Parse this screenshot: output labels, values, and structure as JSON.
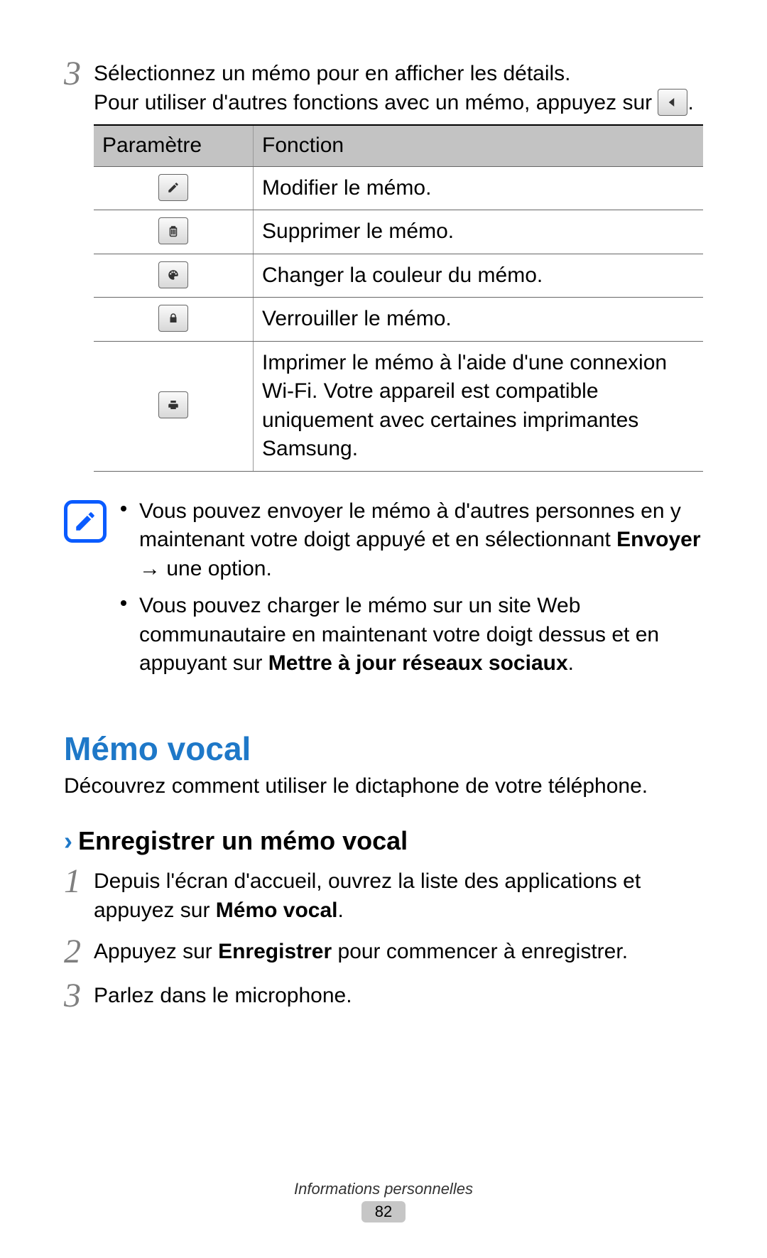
{
  "step3": {
    "number": "3",
    "line1": "Sélectionnez un mémo pour en afficher les détails.",
    "line2a": "Pour utiliser d'autres fonctions avec un mémo, appuyez sur ",
    "line2b": "."
  },
  "table": {
    "headers": {
      "param": "Paramètre",
      "fn": "Fonction"
    },
    "rows": [
      {
        "icon": "edit",
        "fn": "Modifier le mémo."
      },
      {
        "icon": "trash",
        "fn": "Supprimer le mémo."
      },
      {
        "icon": "palette",
        "fn": "Changer la couleur du mémo."
      },
      {
        "icon": "lock",
        "fn": "Verrouiller le mémo."
      },
      {
        "icon": "printer",
        "fn": "Imprimer le mémo à l'aide d'une connexion Wi-Fi. Votre appareil est compatible uniquement avec certaines imprimantes Samsung."
      }
    ]
  },
  "note": {
    "bullet1a": "Vous pouvez envoyer le mémo à d'autres personnes en y maintenant votre doigt appuyé et en sélectionnant ",
    "bullet1b": "Envoyer",
    "bullet1c": " → une option.",
    "bullet2a": "Vous pouvez charger le mémo sur un site Web communautaire en maintenant votre doigt dessus et en appuyant sur ",
    "bullet2b": "Mettre à jour réseaux sociaux",
    "bullet2c": "."
  },
  "section": {
    "title": "Mémo vocal"
  },
  "section_intro": "Découvrez comment utiliser le dictaphone de votre téléphone.",
  "sub": {
    "title": "Enregistrer un mémo vocal"
  },
  "steps": {
    "s1": {
      "number": "1",
      "a": "Depuis l'écran d'accueil, ouvrez la liste des applications et appuyez sur ",
      "b": "Mémo vocal",
      "c": "."
    },
    "s2": {
      "number": "2",
      "a": "Appuyez sur ",
      "b": "Enregistrer",
      "c": " pour commencer à enregistrer."
    },
    "s3": {
      "number": "3",
      "a": "Parlez dans le microphone."
    }
  },
  "footer": {
    "category": "Informations personnelles",
    "page": "82"
  }
}
